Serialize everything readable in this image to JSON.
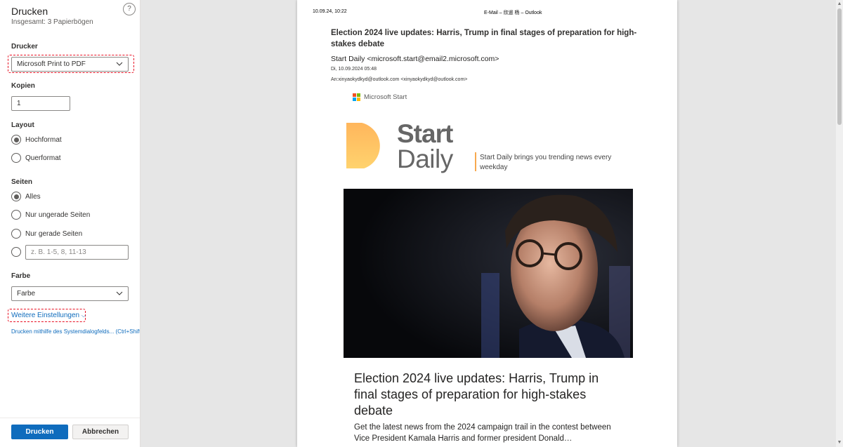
{
  "panel": {
    "title": "Drucken",
    "subtitle": "Insgesamt: 3 Papierbögen",
    "help_label": "?",
    "printer": {
      "label": "Drucker",
      "value": "Microsoft Print to PDF"
    },
    "copies": {
      "label": "Kopien",
      "value": "1"
    },
    "layout": {
      "label": "Layout",
      "options": [
        "Hochformat",
        "Querformat"
      ],
      "selected": "Hochformat"
    },
    "pages": {
      "label": "Seiten",
      "options": [
        "Alles",
        "Nur ungerade Seiten",
        "Nur gerade Seiten"
      ],
      "selected": "Alles",
      "custom_placeholder": "z. B. 1-5, 8, 11-13"
    },
    "color": {
      "label": "Farbe",
      "value": "Farbe"
    },
    "more_settings": "Weitere Einstellungen",
    "system_dialog": "Drucken mithilfe des Systemdialogfelds... (Ctrl+Shift+P)",
    "print_button": "Drucken",
    "cancel_button": "Abbrechen"
  },
  "preview": {
    "header_left": "10.09.24, 10:22",
    "header_center": "E-Mail – 欣遥 杨 – Outlook",
    "subject": "Election 2024 live updates: Harris, Trump in final stages of preparation for high-stakes debate",
    "from": "Start Daily <microsoft.start@email2.microsoft.com>",
    "date": "Di, 10.09.2024 05:48",
    "to": "An:xinyaokydkyd@outlook.com <xinyaokydkyd@outlook.com>",
    "ms_logo_text": "Microsoft Start",
    "brand_start": "Start",
    "brand_daily": "Daily",
    "tagline": "Start Daily brings you trending news every weekday",
    "card_title": "Election 2024 live updates: Harris, Trump in final stages of preparation for high-stakes debate",
    "card_desc": "Get the latest news from the 2024 campaign trail in the contest between Vice President Kamala Harris and former president Donald…",
    "colors": {
      "ms_red": "#f25022",
      "ms_green": "#7fba00",
      "ms_blue": "#00a4ef",
      "ms_yellow": "#ffb900",
      "brand_orange": "#f7a94f"
    }
  }
}
